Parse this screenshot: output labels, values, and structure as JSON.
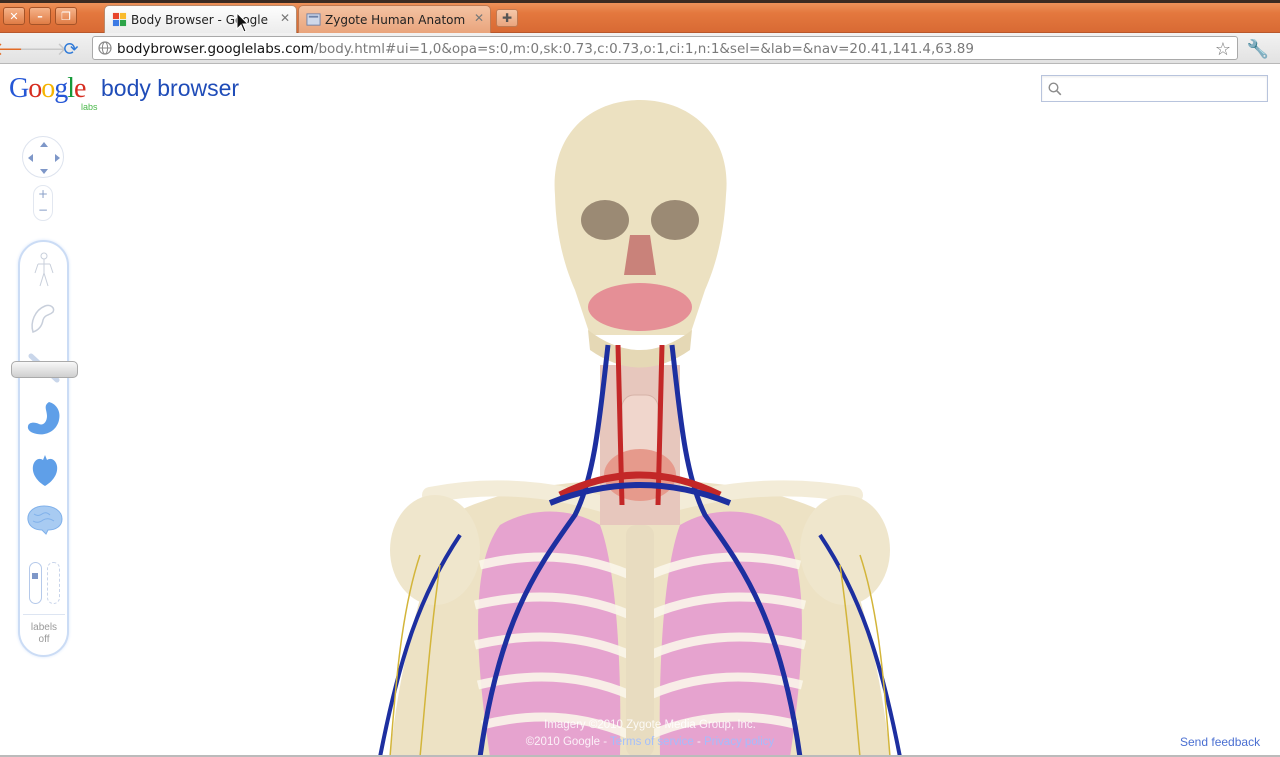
{
  "browser": {
    "tabs": [
      {
        "title": "Body Browser - Google ...",
        "active": true
      },
      {
        "title": "Zygote Human Anatom...",
        "active": false
      }
    ],
    "url_host": "bodybrowser.googlelabs.com",
    "url_path": "/body.html#ui=1,0&opa=s:0,m:0,sk:0.73,c:0.73,o:1,ci:1,n:1&sel=&lab=&nav=20.41,141.4,63.89"
  },
  "header": {
    "logo_letters": [
      "G",
      "o",
      "o",
      "g",
      "l",
      "e"
    ],
    "logo_sub": "labs",
    "product_name": "body browser",
    "search_placeholder": ""
  },
  "layers": {
    "items": [
      "skin-layer",
      "muscle-layer",
      "skeleton-layer",
      "organs-layer",
      "circulatory-layer",
      "nervous-layer"
    ],
    "active": "skeleton-layer",
    "labels_text": [
      "labels",
      "off"
    ]
  },
  "footer": {
    "imagery_credit": "Imagery ©2010 Zygote Media Group, Inc.",
    "copyright": "©2010 Google",
    "terms_link": "Terms of service",
    "privacy_link": "Privacy policy",
    "feedback_link": "Send feedback"
  },
  "colors": {
    "google_blue": "#1f4cb8",
    "titlebar_orange": "#e4783e",
    "layer_icon_blue": "#5f9fe8"
  }
}
